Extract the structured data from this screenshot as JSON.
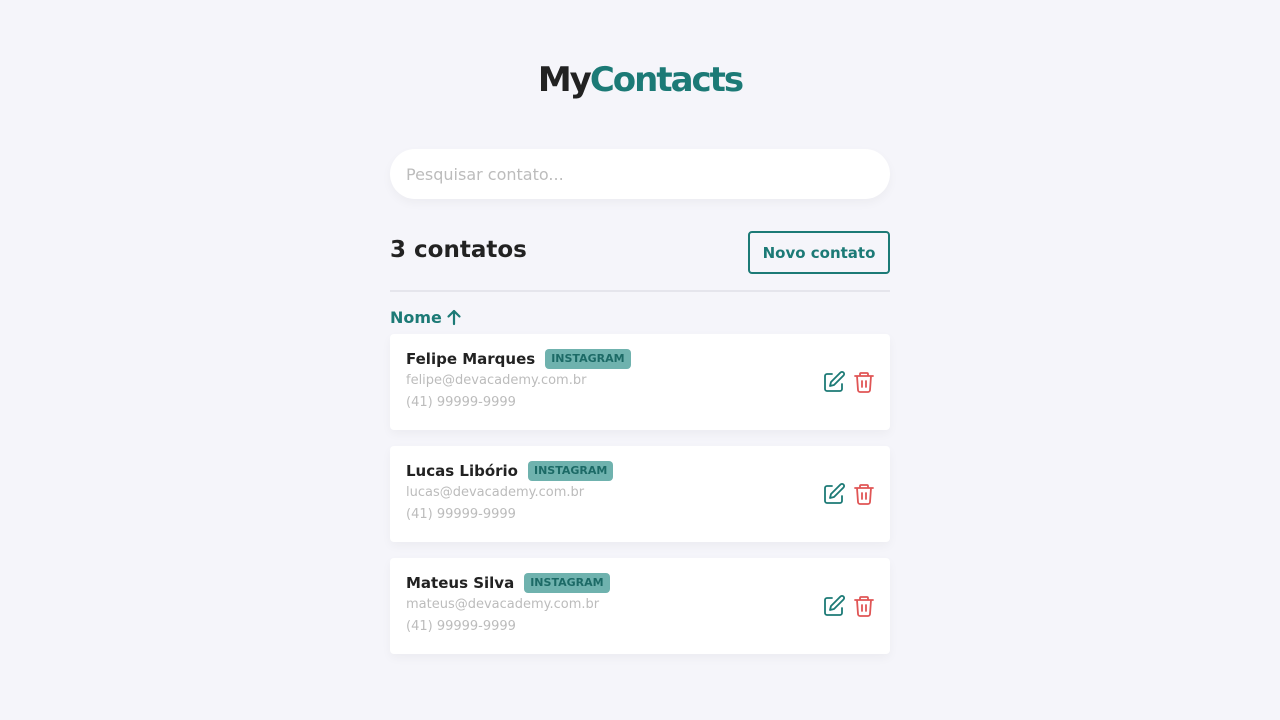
{
  "logo": {
    "part1": "My",
    "part2": "Contacts"
  },
  "search": {
    "placeholder": "Pesquisar contato..."
  },
  "header": {
    "count_label": "3 contatos",
    "new_button_label": "Novo contato"
  },
  "sort": {
    "label": "Nome",
    "direction_icon": "arrow-up-icon"
  },
  "contacts": [
    {
      "name": "Felipe Marques",
      "category": "INSTAGRAM",
      "email": "felipe@devacademy.com.br",
      "phone": "(41) 99999-9999"
    },
    {
      "name": "Lucas Libório",
      "category": "INSTAGRAM",
      "email": "lucas@devacademy.com.br",
      "phone": "(41) 99999-9999"
    },
    {
      "name": "Mateus Silva",
      "category": "INSTAGRAM",
      "email": "mateus@devacademy.com.br",
      "phone": "(41) 99999-9999"
    }
  ],
  "icons": {
    "edit": "edit-icon",
    "delete": "trash-icon"
  },
  "colors": {
    "primary": "#1c7a76",
    "danger": "#e05555",
    "badge": "#6fb2ae",
    "background": "#f5f5fa",
    "muted_text": "#bcbcbc"
  }
}
